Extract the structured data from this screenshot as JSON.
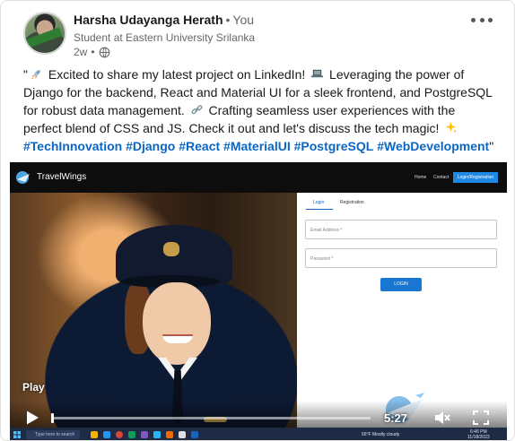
{
  "post": {
    "author": {
      "name": "Harsha Udayanga Herath",
      "relation": "You",
      "headline": "Student at Eastern University Srilanka",
      "time_ago": "2w",
      "avatar_ribbon_text": "#OPENTOWORK"
    },
    "body": {
      "line1_pre": "\"",
      "line1": " Excited to share my latest project on LinkedIn! ",
      "line1b": " Leveraging the power of Django for the backend, React and Material UI for a sleek frontend, and PostgreSQL for robust data management. ",
      "line2": " Crafting seamless user experiences with the perfect blend of CSS and JS. Check it out and let's discuss the tech magic! ",
      "hashtags": [
        "#TechInnovation",
        "#Django",
        "#React",
        "#MaterialUI",
        "#PostgreSQL",
        "#WebDevelopment"
      ],
      "closing_quote": "\""
    }
  },
  "video": {
    "site": {
      "brand": "TravelWings",
      "nav": [
        "Home",
        "Contact"
      ],
      "nav_button": "Login/Registration",
      "tabs": [
        "Login",
        "Registration"
      ],
      "email_placeholder": "Email Address *",
      "password_placeholder": "Password *",
      "login_button": "LOGIN"
    },
    "play_label": "Play",
    "time_remaining": "5:27",
    "progress_fraction": 0.0,
    "taskbar": {
      "search_placeholder": "Type here to search",
      "weather": "56°F Mostly cloudy",
      "time": "6:46 PM",
      "date": "11/18/2023"
    }
  },
  "colors": {
    "hashtag": "#0a66c2",
    "meta_text": "#666666",
    "video_nav_button": "#1e88e5",
    "login_button": "#1976d2"
  },
  "icons": {
    "post_emojis": [
      "rocket-icon",
      "laptop-icon",
      "link-icon",
      "sparkles-icon"
    ],
    "more": "ellipsis-icon",
    "visibility": "globe-icon",
    "player": [
      "play-icon",
      "mute-icon",
      "fullscreen-icon"
    ]
  }
}
